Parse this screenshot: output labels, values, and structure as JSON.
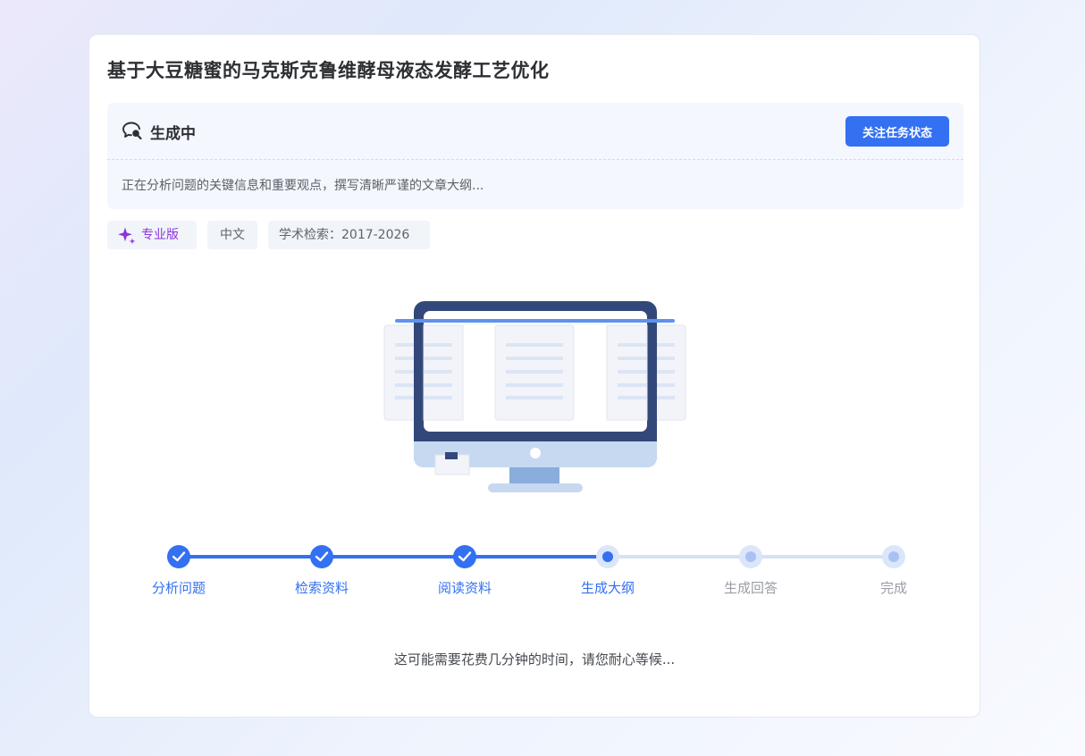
{
  "report": {
    "title": "基于大豆糖蜜的马克斯克鲁维酵母液态发酵工艺优化"
  },
  "status": {
    "label": "生成中",
    "follow_button": "关注任务状态",
    "description": "正在分析问题的关键信息和重要观点，撰写清晰严谨的文章大纲..."
  },
  "tags": {
    "edition": "专业版",
    "language": "中文",
    "academic_range": "学术检索：2017-2026"
  },
  "steps": [
    {
      "label": "分析问题",
      "state": "done"
    },
    {
      "label": "检索资料",
      "state": "done"
    },
    {
      "label": "阅读资料",
      "state": "done"
    },
    {
      "label": "生成大纲",
      "state": "active"
    },
    {
      "label": "生成回答",
      "state": "pending"
    },
    {
      "label": "完成",
      "state": "pending"
    }
  ],
  "hint": "这可能需要花费几分钟的时间，请您耐心等候...",
  "icons": {
    "status": "search-bubble-icon",
    "edition": "sparkle-icon",
    "step_done": "check-icon"
  },
  "colors": {
    "accent": "#3370f2",
    "edition": "#8b33e0",
    "pending": "#a9c1f3"
  }
}
